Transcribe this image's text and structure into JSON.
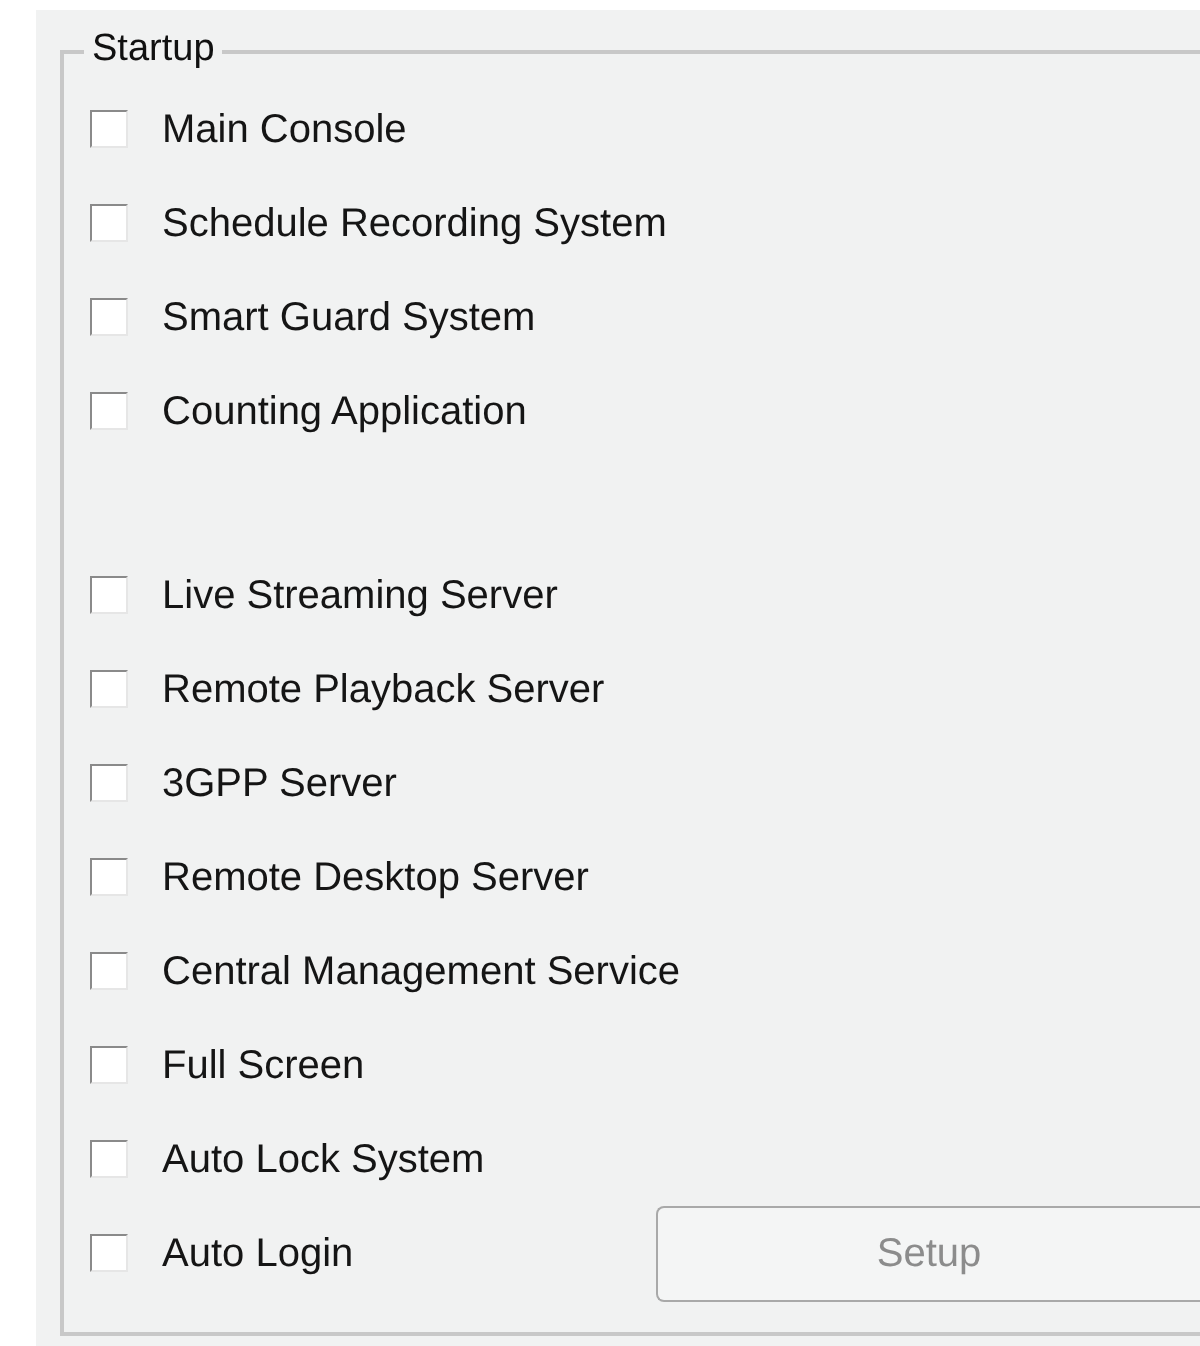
{
  "group": {
    "title": "Startup",
    "sections": [
      [
        {
          "label": "Main Console",
          "checked": false
        },
        {
          "label": "Schedule Recording System",
          "checked": false
        },
        {
          "label": "Smart Guard System",
          "checked": false
        },
        {
          "label": "Counting Application",
          "checked": false
        }
      ],
      [
        {
          "label": "Live Streaming Server",
          "checked": false
        },
        {
          "label": "Remote Playback Server",
          "checked": false
        },
        {
          "label": "3GPP Server",
          "checked": false
        },
        {
          "label": "Remote Desktop Server",
          "checked": false
        },
        {
          "label": "Central Management Service",
          "checked": false
        },
        {
          "label": "Full Screen",
          "checked": false
        },
        {
          "label": "Auto Lock System",
          "checked": false
        },
        {
          "label": "Auto Login",
          "checked": false
        }
      ]
    ],
    "setup_button": {
      "label": "Setup",
      "disabled": true
    }
  }
}
